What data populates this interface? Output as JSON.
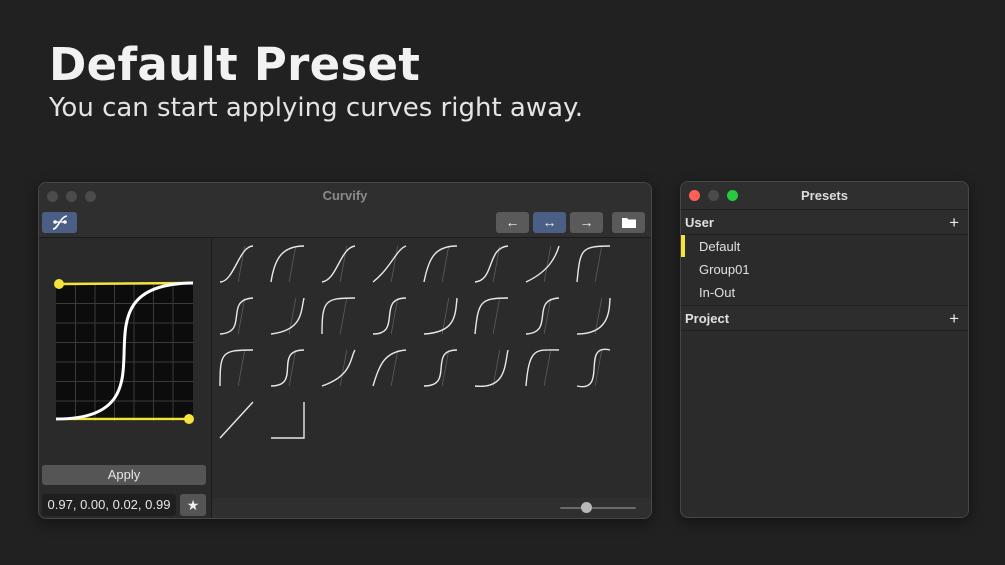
{
  "hero": {
    "title": "Default Preset",
    "subtitle": "You can start applying curves right away."
  },
  "curvify_window": {
    "title": "Curvify",
    "toolbar": {
      "curve_tool_icon": "bezier-curve-icon",
      "arrow_left": "←",
      "arrow_both": "↔",
      "arrow_right": "→",
      "folder_icon": "folder-icon"
    },
    "editor": {
      "apply_label": "Apply",
      "values": "0.97, 0.00, 0.02, 0.99",
      "star_label": "★",
      "handle_color": "#f2e43a",
      "curve_color": "#ffffff"
    },
    "thumbnail_count": 26,
    "size_slider_value": 0.35
  },
  "presets_window": {
    "title": "Presets",
    "sections": [
      {
        "name": "User",
        "add_label": "+",
        "items": [
          "Default",
          "Group01",
          "In-Out"
        ],
        "selected": "Default"
      },
      {
        "name": "Project",
        "add_label": "+",
        "items": []
      }
    ]
  },
  "colors": {
    "background": "#212121",
    "accent_selected": "#f2e43a",
    "active_button": "#4b5f86"
  }
}
